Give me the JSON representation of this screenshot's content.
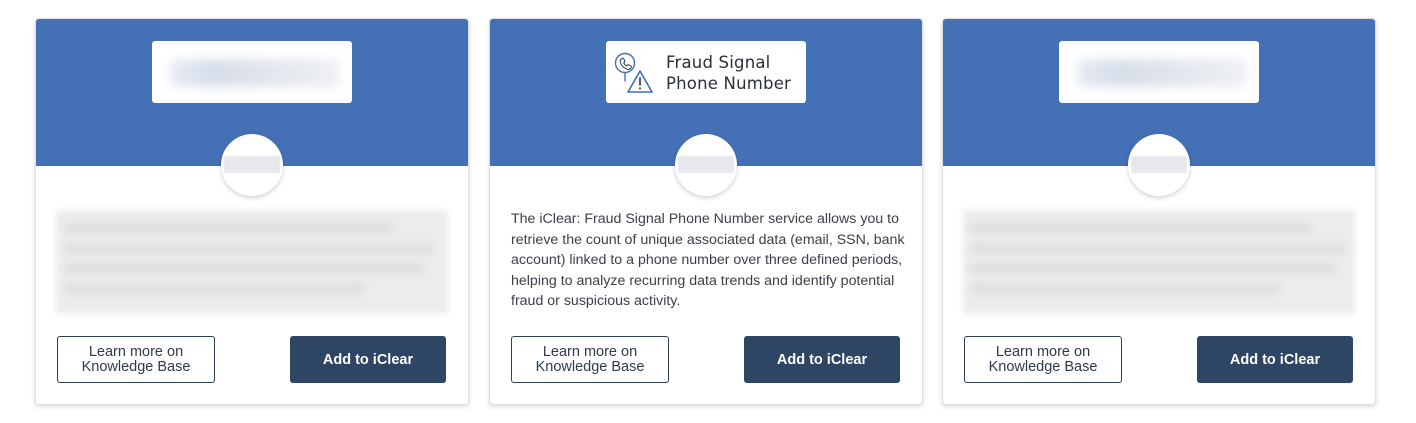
{
  "cards": [
    {
      "logo_text": "",
      "description": "",
      "learn_more_label": "Learn more on Knowledge Base",
      "add_label": "Add to iClear"
    },
    {
      "logo_text": "Fraud Signal Phone Number",
      "logo_icon": "phone-warning-icon",
      "description": "The iClear: Fraud Signal Phone Number service allows you to retrieve the count of unique associated data (email, SSN, bank account) linked to a phone number over three defined periods, helping to analyze recurring data trends and identify potential fraud or suspicious activity.",
      "learn_more_label": "Learn more on Knowledge Base",
      "add_label": "Add to iClear"
    },
    {
      "logo_text": "",
      "description": "",
      "learn_more_label": "Learn more on Knowledge Base",
      "add_label": "Add to iClear"
    }
  ],
  "colors": {
    "header_blue": "#4470b5",
    "button_dark": "#2e4563",
    "text": "#3d4048"
  }
}
